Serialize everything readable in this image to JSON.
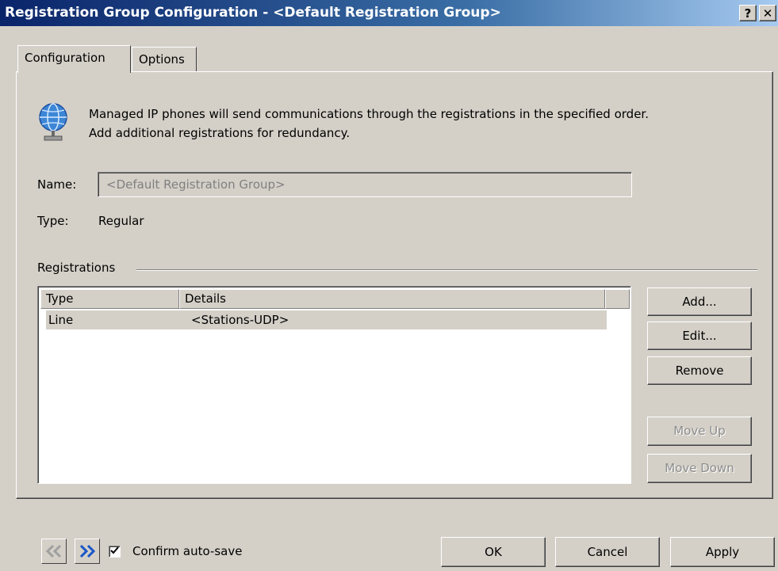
{
  "window": {
    "title": "Registration Group Configuration - <Default Registration Group>",
    "help_glyph": "?",
    "close_glyph": "✕"
  },
  "tabs": [
    {
      "label": "Configuration",
      "active": true
    },
    {
      "label": "Options",
      "active": false
    }
  ],
  "info": {
    "icon": "globe-network-icon",
    "line1": "Managed IP phones will send communications through the registrations in the specified order.",
    "line2": "Add additional registrations for redundancy."
  },
  "fields": {
    "name_label": "Name:",
    "name_value": "<Default Registration Group>",
    "type_label": "Type:",
    "type_value": "Regular"
  },
  "registrations": {
    "group_label": "Registrations",
    "columns": [
      "Type",
      "Details"
    ],
    "rows": [
      {
        "type": "Line",
        "details": "<Stations-UDP>"
      }
    ]
  },
  "side_buttons": {
    "add": "Add...",
    "edit": "Edit...",
    "remove": "Remove",
    "move_up": "Move Up",
    "move_down": "Move Down"
  },
  "footer": {
    "back_icon": "double-chevron-left-icon",
    "forward_icon": "double-chevron-right-icon",
    "confirm_label": "Confirm auto-save",
    "confirm_checked": true,
    "ok": "OK",
    "cancel": "Cancel",
    "apply": "Apply"
  },
  "colors": {
    "title_bar_start": "#0a246a",
    "title_bar_end": "#a6caf0",
    "face": "#d4d0c8",
    "forward_arrow": "#1a56c8",
    "back_arrow": "#a0a0a0"
  }
}
